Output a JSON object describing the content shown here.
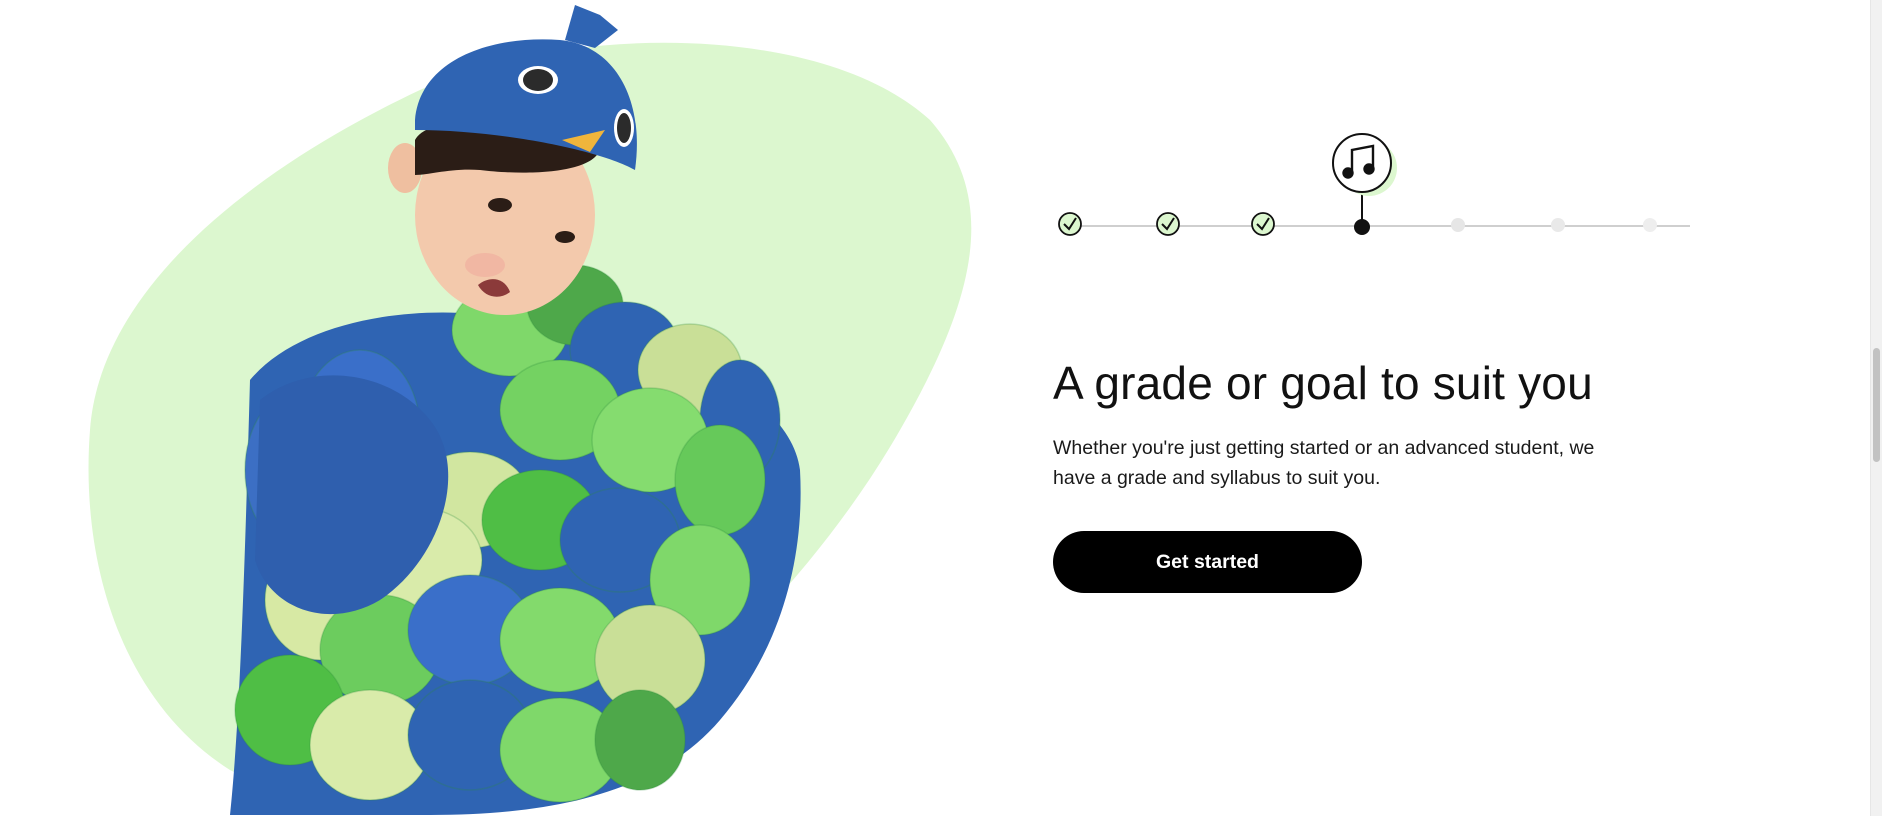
{
  "section": {
    "title": "A grade or goal to suit you",
    "description": "Whether you're just getting started or an advanced student, we have a grade and syllabus to suit you.",
    "cta_label": "Get started"
  },
  "progress": {
    "completed_steps": 3,
    "current_step": 4,
    "total_steps": 7,
    "current_icon": "music-note-icon"
  },
  "colors": {
    "accent_green": "#dcf7cf",
    "button_bg": "#000000",
    "button_text": "#ffffff"
  }
}
